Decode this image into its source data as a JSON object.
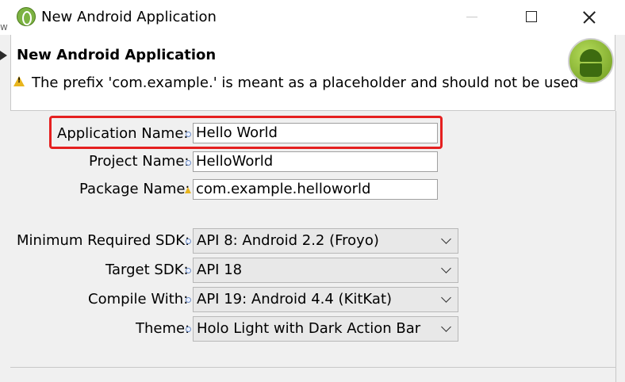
{
  "window": {
    "title": "New Android Application",
    "edge_text": "w"
  },
  "banner": {
    "title": "New Android Application",
    "message": "The prefix 'com.example.' is meant as a placeholder and should not be used"
  },
  "form": {
    "application_name": {
      "label": "Application Name:",
      "value": "Hello World"
    },
    "project_name": {
      "label": "Project Name:",
      "value": "HelloWorld"
    },
    "package_name": {
      "label": "Package Name:",
      "value": "com.example.helloworld"
    },
    "min_sdk": {
      "label": "Minimum Required SDK:",
      "value": "API 8: Android 2.2 (Froyo)"
    },
    "target_sdk": {
      "label": "Target SDK:",
      "value": "API 18"
    },
    "compile_with": {
      "label": "Compile With:",
      "value": "API 19: Android 4.4 (KitKat)"
    },
    "theme": {
      "label": "Theme:",
      "value": "Holo Light with Dark Action Bar"
    }
  },
  "colors": {
    "highlight_border": "#e52020",
    "warning": "#e8b51d",
    "android_green": "#7cb342"
  }
}
